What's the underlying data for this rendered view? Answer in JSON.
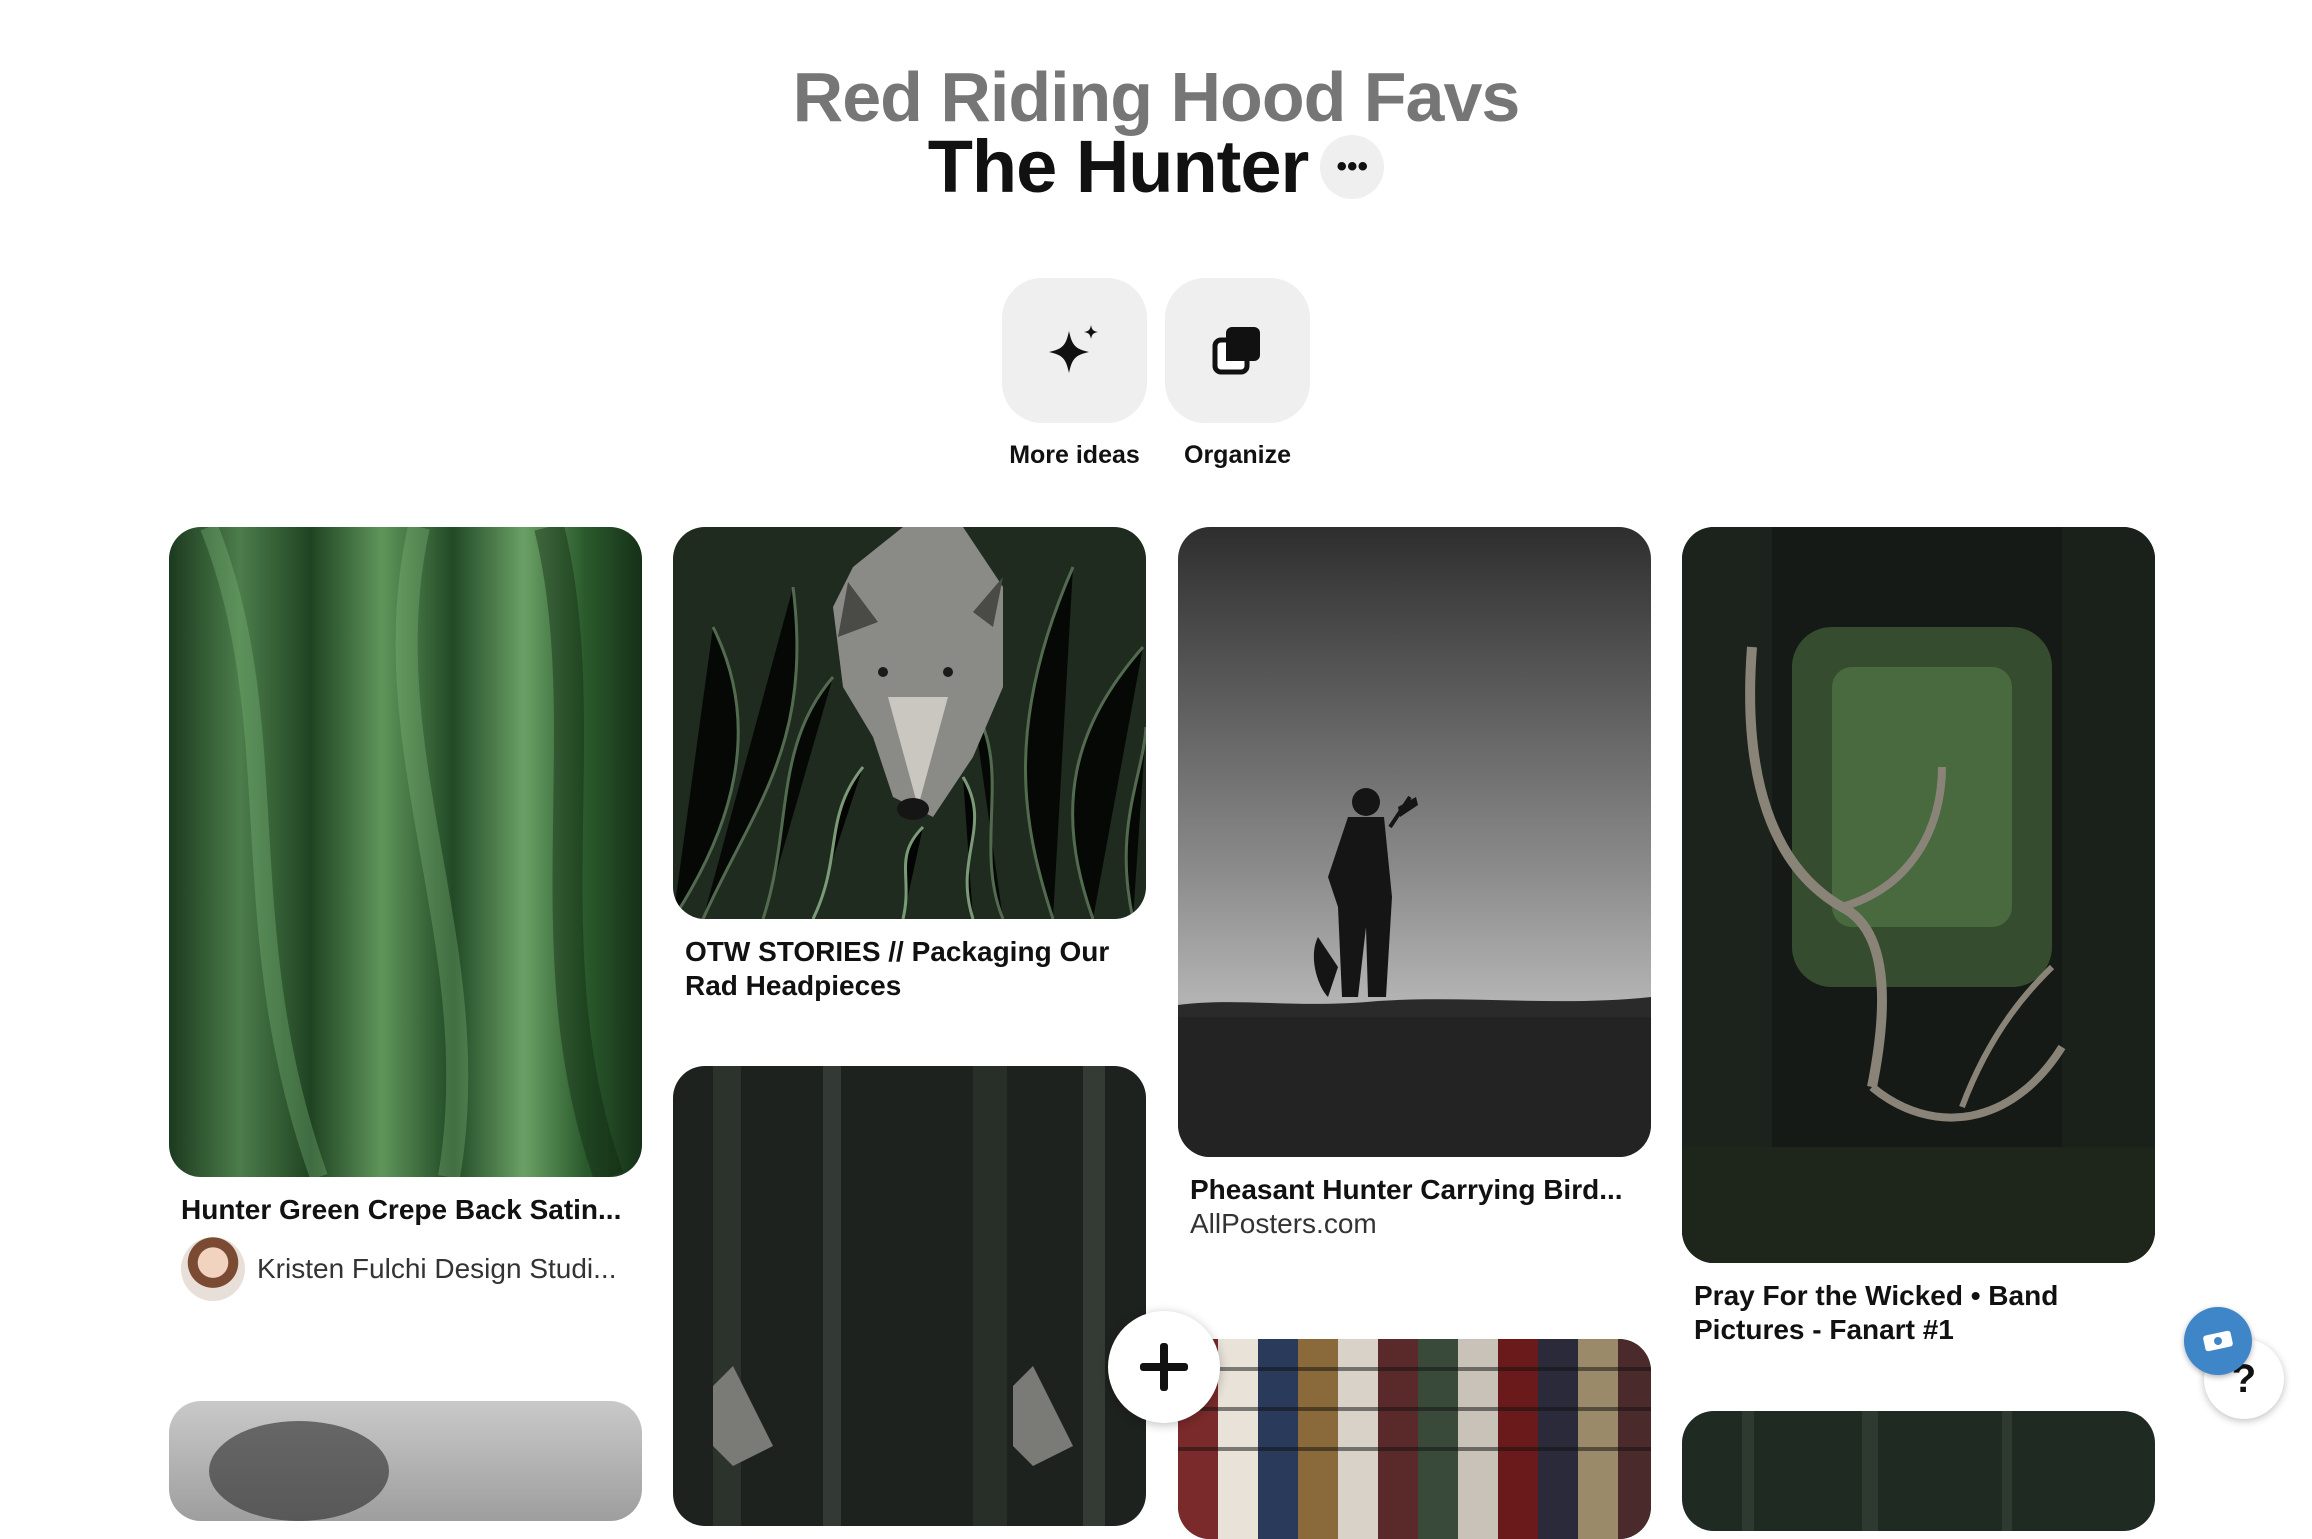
{
  "board": {
    "name": "Red Riding Hood Favs",
    "section": "The Hunter",
    "more_icon": "ellipsis-icon"
  },
  "actions": [
    {
      "label": "More ideas",
      "icon": "sparkle-icon"
    },
    {
      "label": "Organize",
      "icon": "stack-icon"
    }
  ],
  "pins": [
    {
      "title": "Hunter Green Crepe Back Satin...",
      "user": "Kristen Fulchi Design Studi..."
    },
    {
      "title": "OTW STORIES // Packaging Our Rad Headpieces"
    },
    {
      "title": "Pheasant Hunter Carrying Bird...",
      "source": "AllPosters.com"
    },
    {
      "title": "Pray For the Wicked • Band Pictures - Fanart #1"
    }
  ],
  "fab": {
    "icon": "plus-icon"
  },
  "help": {
    "label": "?"
  }
}
